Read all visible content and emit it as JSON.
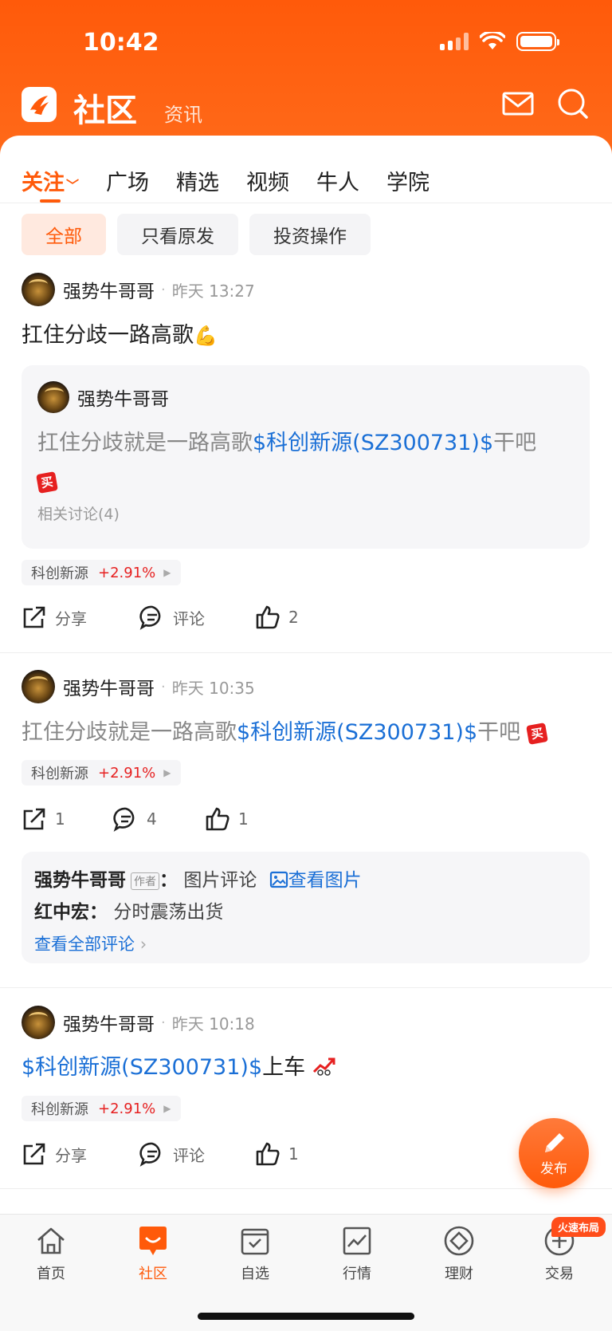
{
  "status_bar": {
    "time": "10:42"
  },
  "header": {
    "title": "社区",
    "subtitle": "资讯"
  },
  "tabs": [
    {
      "label": "关注",
      "active": true
    },
    {
      "label": "广场"
    },
    {
      "label": "精选"
    },
    {
      "label": "视频"
    },
    {
      "label": "牛人"
    },
    {
      "label": "学院"
    }
  ],
  "filters": [
    "全部",
    "只看原发",
    "投资操作"
  ],
  "posts": [
    {
      "author": "强势牛哥哥",
      "time": "昨天 13:27",
      "text": "扛住分歧一路高歌",
      "emoji": "💪",
      "quote": {
        "author": "强势牛哥哥",
        "text_prefix": "扛住分歧就是一路高歌",
        "stock": "$科创新源(SZ300731)$",
        "text_suffix": "干吧",
        "badge": "买",
        "related": "相关讨论(4)"
      },
      "stock_tag": {
        "name": "科创新源",
        "change": "+2.91%"
      },
      "actions": {
        "share": "分享",
        "comment": "评论",
        "like": "2"
      }
    },
    {
      "author": "强势牛哥哥",
      "time": "昨天 10:35",
      "text_prefix": "扛住分歧就是一路高歌",
      "stock": "$科创新源(SZ300731)$",
      "text_suffix": "干吧",
      "badge": "买",
      "stock_tag": {
        "name": "科创新源",
        "change": "+2.91%"
      },
      "actions": {
        "share": "1",
        "comment": "4",
        "like": "1"
      },
      "comments": [
        {
          "user": "强势牛哥哥",
          "badge": "作者",
          "text": "图片评论",
          "link": "查看图片"
        },
        {
          "user": "红中宏",
          "text": "分时震荡出货"
        }
      ],
      "all_comments": "查看全部评论"
    },
    {
      "author": "强势牛哥哥",
      "time": "昨天 10:18",
      "stock": "$科创新源(SZ300731)$",
      "text_suffix": "上车",
      "stock_tag": {
        "name": "科创新源",
        "change": "+2.91%"
      },
      "actions": {
        "share": "分享",
        "comment": "评论",
        "like": "1"
      }
    }
  ],
  "fab": {
    "label": "发布"
  },
  "bottom_nav": [
    {
      "label": "首页",
      "icon": "home-icon"
    },
    {
      "label": "社区",
      "icon": "community-icon",
      "active": true
    },
    {
      "label": "自选",
      "icon": "watchlist-icon"
    },
    {
      "label": "行情",
      "icon": "market-icon"
    },
    {
      "label": "理财",
      "icon": "wealth-icon"
    },
    {
      "label": "交易",
      "icon": "trade-icon"
    }
  ],
  "promo_badge": "火速布局",
  "colors": {
    "brand": "#ff5a0a",
    "link": "#1a6fd6",
    "up": "#e62020"
  }
}
